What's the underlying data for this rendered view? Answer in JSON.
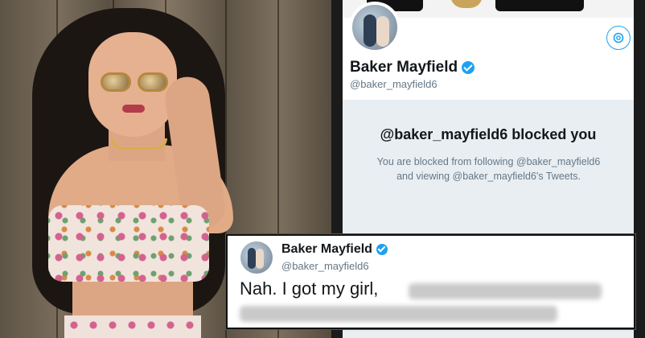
{
  "profile": {
    "display_name": "Baker Mayfield",
    "handle": "@baker_mayfield6",
    "settings_icon": "gear-icon",
    "verified_icon": "verified-badge-icon"
  },
  "blocked_notice": {
    "title": "@baker_mayfield6 blocked you",
    "message_line1": "You are blocked from following @baker_mayfield6",
    "message_line2": "and viewing @baker_mayfield6's Tweets."
  },
  "tweet": {
    "display_name": "Baker Mayfield",
    "handle": "@baker_mayfield6",
    "text_visible": "Nah. I got my girl,"
  },
  "colors": {
    "twitter_blue": "#1da1f2",
    "text_primary": "#14171a",
    "text_secondary": "#657786"
  }
}
